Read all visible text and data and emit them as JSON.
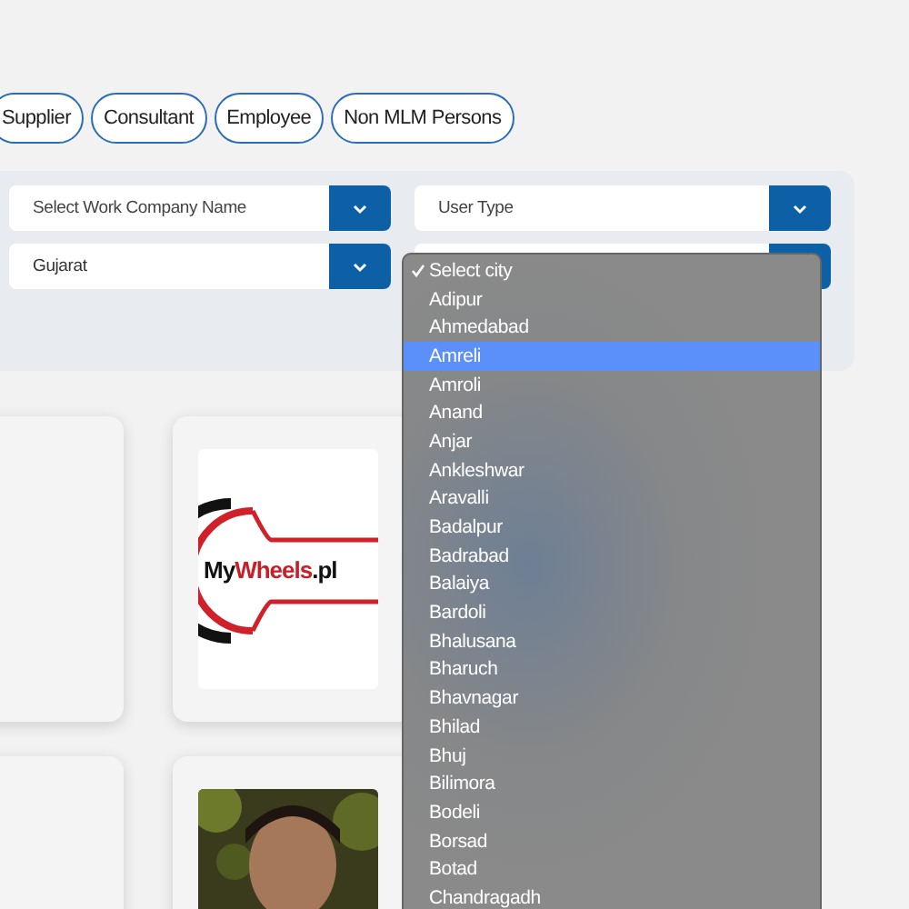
{
  "role_tabs": [
    {
      "label": "Supplier"
    },
    {
      "label": "Consultant"
    },
    {
      "label": "Employee"
    },
    {
      "label": "Non MLM Persons"
    }
  ],
  "filters": [
    {
      "placeholder": "Select Work Company Name"
    },
    {
      "placeholder": "User Type"
    },
    {
      "value": "Gujarat"
    }
  ],
  "city_dropdown": {
    "options": [
      {
        "label": "Select city",
        "checked": true,
        "highlighted": false
      },
      {
        "label": "Adipur",
        "checked": false,
        "highlighted": false
      },
      {
        "label": "Ahmedabad",
        "checked": false,
        "highlighted": false
      },
      {
        "label": "Amreli",
        "checked": false,
        "highlighted": true
      },
      {
        "label": "Amroli",
        "checked": false,
        "highlighted": false
      },
      {
        "label": "Anand",
        "checked": false,
        "highlighted": false
      },
      {
        "label": "Anjar",
        "checked": false,
        "highlighted": false
      },
      {
        "label": "Ankleshwar",
        "checked": false,
        "highlighted": false
      },
      {
        "label": "Aravalli",
        "checked": false,
        "highlighted": false
      },
      {
        "label": "Badalpur",
        "checked": false,
        "highlighted": false
      },
      {
        "label": "Badrabad",
        "checked": false,
        "highlighted": false
      },
      {
        "label": "Balaiya",
        "checked": false,
        "highlighted": false
      },
      {
        "label": "Bardoli",
        "checked": false,
        "highlighted": false
      },
      {
        "label": "Bhalusana",
        "checked": false,
        "highlighted": false
      },
      {
        "label": "Bharuch",
        "checked": false,
        "highlighted": false
      },
      {
        "label": "Bhavnagar",
        "checked": false,
        "highlighted": false
      },
      {
        "label": "Bhilad",
        "checked": false,
        "highlighted": false
      },
      {
        "label": "Bhuj",
        "checked": false,
        "highlighted": false
      },
      {
        "label": "Bilimora",
        "checked": false,
        "highlighted": false
      },
      {
        "label": "Bodeli",
        "checked": false,
        "highlighted": false
      },
      {
        "label": "Borsad",
        "checked": false,
        "highlighted": false
      },
      {
        "label": "Botad",
        "checked": false,
        "highlighted": false
      },
      {
        "label": "Chandragadh",
        "checked": false,
        "highlighted": false
      }
    ]
  },
  "cards": [
    {
      "kind": "blank"
    },
    {
      "kind": "logo",
      "logo_text": [
        "My",
        "Wheels",
        ".pl"
      ]
    },
    {
      "kind": "blank"
    },
    {
      "kind": "picture"
    }
  ]
}
